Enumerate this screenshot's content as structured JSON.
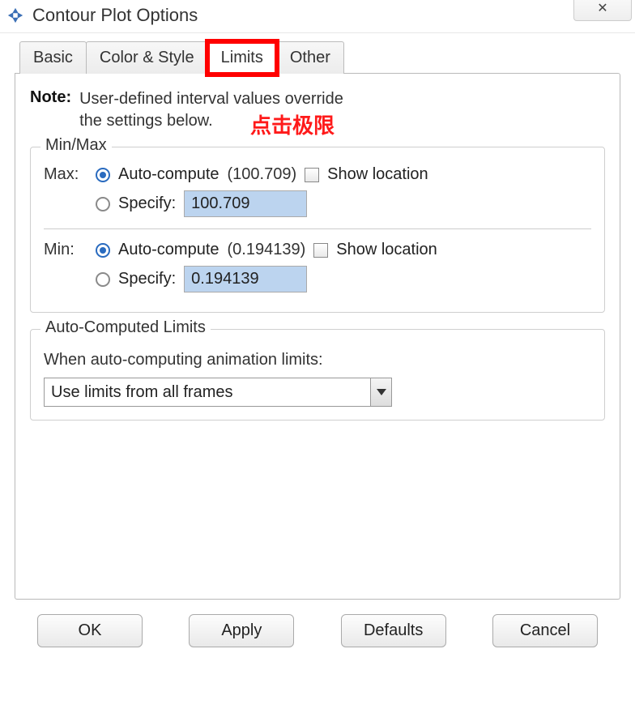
{
  "window": {
    "title": "Contour Plot Options",
    "close_glyph": "✕"
  },
  "tabs": {
    "basic": "Basic",
    "color_style": "Color & Style",
    "limits": "Limits",
    "other": "Other"
  },
  "note": {
    "label": "Note:",
    "text_line1": "User-defined interval values override",
    "text_line2": "the settings below."
  },
  "annotation": "点击极限",
  "minmax": {
    "legend": "Min/Max",
    "max_label": "Max:",
    "min_label": "Min:",
    "autocompute_label": "Auto-compute",
    "specify_label": "Specify:",
    "show_location_label": "Show location",
    "max_auto_value": "(100.709)",
    "max_specify_value": "100.709",
    "min_auto_value": "(0.194139)",
    "min_specify_value": "0.194139"
  },
  "autocomputed": {
    "legend": "Auto-Computed Limits",
    "prompt": "When auto-computing animation limits:",
    "selected": "Use limits from all frames"
  },
  "buttons": {
    "ok": "OK",
    "apply": "Apply",
    "defaults": "Defaults",
    "cancel": "Cancel"
  }
}
